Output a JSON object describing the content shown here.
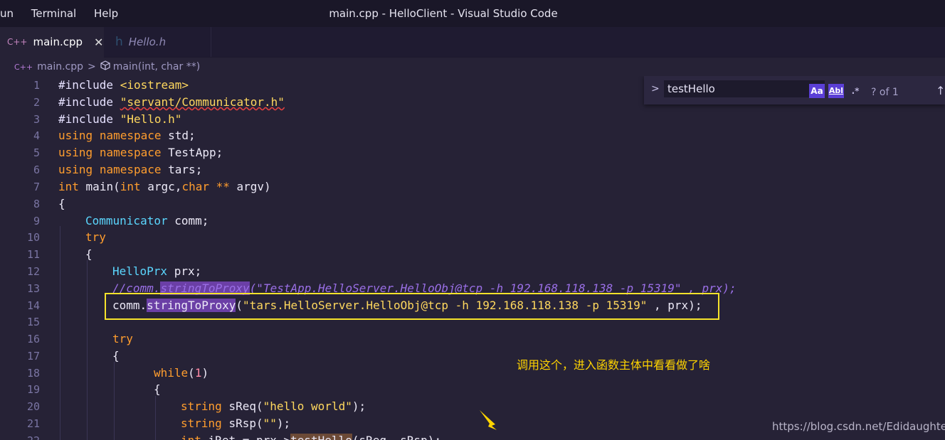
{
  "menu": [
    "un",
    "Terminal",
    "Help"
  ],
  "window_title": "main.cpp - HelloClient - Visual Studio Code",
  "tabs": [
    {
      "icon": "C++",
      "label": "main.cpp",
      "close": "✕"
    },
    {
      "icon": "h",
      "label": "Hello.h"
    }
  ],
  "breadcrumb": {
    "file_icon": "C++",
    "file": "main.cpp",
    "sep": ">",
    "symbol": "main(int, char **)"
  },
  "find": {
    "chevron": ">",
    "value": "testHello",
    "opt_case": "Aa",
    "opt_word": "Abl",
    "opt_regex": ".*",
    "count": "? of 1",
    "up": "↑"
  },
  "line_numbers": [
    "1",
    "2",
    "3",
    "4",
    "5",
    "6",
    "7",
    "8",
    "9",
    "10",
    "11",
    "12",
    "13",
    "14",
    "15",
    "16",
    "17",
    "18",
    "19",
    "20",
    "21",
    "22"
  ],
  "code": {
    "l1a": "#include",
    "l1b": "<iostream>",
    "l2a": "#include",
    "l2b": "\"servant/Communicator.h\"",
    "l3a": "#include",
    "l3b": "\"Hello.h\"",
    "l4a": "using",
    "l4b": "namespace",
    "l4c": "std;",
    "l5a": "using",
    "l5b": "namespace",
    "l5c": "TestApp;",
    "l6a": "using",
    "l6b": "namespace",
    "l6c": "tars;",
    "l7a": "int",
    "l7b": "main(",
    "l7c": "int",
    "l7d": "argc,",
    "l7e": "char",
    "l7f": "**",
    "l7g": "argv)",
    "l8": "{",
    "l9a": "Communicator",
    "l9b": "comm;",
    "l10": "try",
    "l11": "{",
    "l12a": "HelloPrx",
    "l12b": "prx;",
    "l13a": "//comm.",
    "l13b": "stringToProxy",
    "l13c": "(\"TestApp.HelloServer.HelloObj@tcp -h 192.168.118.138 -p 15319\" , prx);",
    "l14a": "comm.",
    "l14b": "stringToProxy",
    "l14c": "(",
    "l14d": "\"tars.HelloServer.HelloObj@tcp -h 192.168.118.138 -p 15319\"",
    "l14e": " , prx);",
    "l16": "try",
    "l17": "{",
    "l18a": "while",
    "l18b": "(",
    "l18c": "1",
    "l18d": ")",
    "l19": "{",
    "l20a": "string",
    "l20b": "sReq(",
    "l20c": "\"hello world\"",
    "l20d": ");",
    "l21a": "string",
    "l21b": "sRsp(",
    "l21c": "\"\"",
    "l21d": ");",
    "l22a": "int",
    "l22b": "iRet = prx->",
    "l22c": "testHello",
    "l22d": "(sReq, sRsp);"
  },
  "annotation": "调用这个，进入函数主体中看看做了啥",
  "watermark": "https://blog.csdn.net/Edidaughter",
  "colors": {
    "highlight_box": "#f6e32b",
    "annotation": "#ffd400",
    "match_highlight": "#6b3fa6"
  }
}
